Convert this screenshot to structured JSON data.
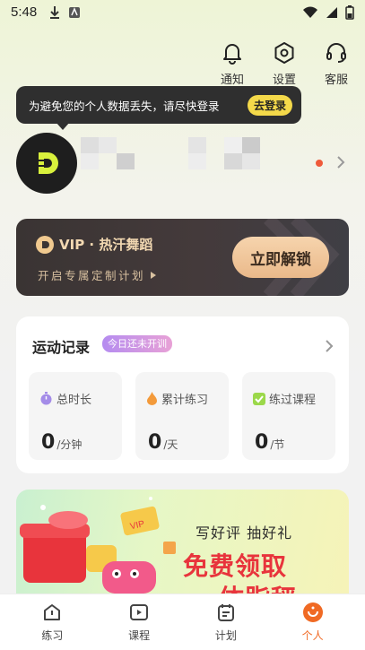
{
  "status_bar": {
    "time": "5:48"
  },
  "top_actions": [
    {
      "icon": "bell-icon",
      "label": "通知"
    },
    {
      "icon": "settings-icon",
      "label": "设置"
    },
    {
      "icon": "headset-icon",
      "label": "客服"
    }
  ],
  "tooltip": {
    "text": "为避免您的个人数据丢失，请尽快登录",
    "button": "去登录"
  },
  "vip": {
    "title": "VIP · 热汗舞蹈",
    "subtitle": "开启专属定制计划",
    "button": "立即解锁"
  },
  "record": {
    "title": "运动记录",
    "badge": "今日还未开训",
    "stats": [
      {
        "icon": "stopwatch-icon",
        "label": "总时长",
        "value": "0",
        "unit": "/分钟"
      },
      {
        "icon": "flame-icon",
        "label": "累计练习",
        "value": "0",
        "unit": "/天"
      },
      {
        "icon": "check-icon",
        "label": "练过课程",
        "value": "0",
        "unit": "/节"
      }
    ]
  },
  "promo": {
    "line1": "写好评 抽好礼",
    "line2": "免费领取",
    "line3": "体脂秤"
  },
  "tabs": [
    {
      "icon": "practice-icon",
      "label": "练习",
      "active": false
    },
    {
      "icon": "course-icon",
      "label": "课程",
      "active": false
    },
    {
      "icon": "plan-icon",
      "label": "计划",
      "active": false
    },
    {
      "icon": "profile-icon",
      "label": "个人",
      "active": true
    }
  ],
  "colors": {
    "accent": "#f06a24",
    "vip_gold": "#f3d9b2",
    "badge": "#c590e6",
    "promo_red": "#e8343c"
  }
}
